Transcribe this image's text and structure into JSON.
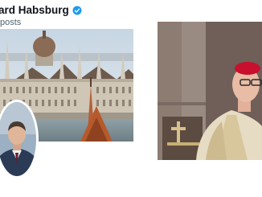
{
  "profile": {
    "display_name": "ard Habsburg",
    "post_count_text": "posts",
    "verified_icon": "verified-badge-icon",
    "verified_color": "#1d9bf0"
  },
  "banner": {
    "subject": "parliament-building-photo"
  },
  "avatar": {
    "subject": "profile-photo"
  },
  "photo": {
    "subject": "cardinal-portrait-photo"
  }
}
